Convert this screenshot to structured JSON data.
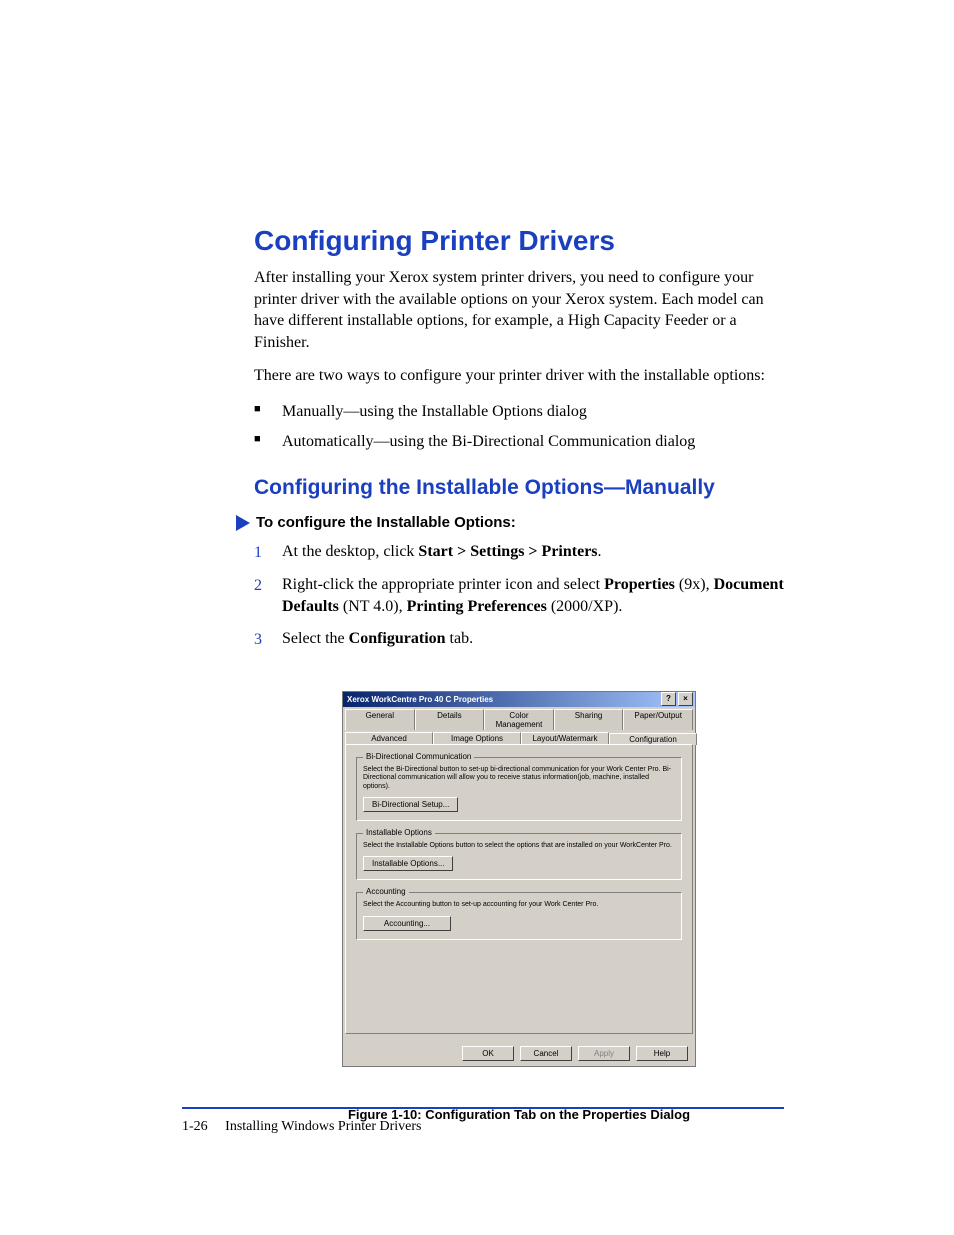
{
  "heading1": "Configuring Printer Drivers",
  "intro": "After installing your Xerox system printer drivers, you need to configure your printer driver with the available options on your Xerox system. Each model can have different installable options, for example, a High Capacity Feeder or a Finisher.",
  "intro2": "There are two ways to configure your printer driver with the installable options:",
  "bullets": [
    "Manually—using the Installable Options dialog",
    "Automatically—using the Bi-Directional Communication dialog"
  ],
  "heading2": "Configuring the Installable Options—Manually",
  "procLabel": "To configure the Installable Options:",
  "steps": {
    "s1a": "At the desktop, click ",
    "s1b": "Start > Settings > Printers",
    "s1c": ".",
    "s2a": "Right-click the appropriate printer icon and select ",
    "s2b": "Properties",
    "s2c": " (9x), ",
    "s2d": "Document Defaults",
    "s2e": " (NT 4.0), ",
    "s2f": "Printing Preferences",
    "s2g": " (2000/XP).",
    "s3a": "Select the ",
    "s3b": "Configuration",
    "s3c": " tab."
  },
  "dialog": {
    "title": "Xerox WorkCentre Pro 40 C Properties",
    "help": "?",
    "close": "×",
    "tabsRow1": [
      "General",
      "Details",
      "Color Management",
      "Sharing",
      "Paper/Output"
    ],
    "tabsRow2": [
      "Advanced",
      "Image Options",
      "Layout/Watermark",
      "Configuration"
    ],
    "group1": {
      "legend": "Bi-Directional Communication",
      "desc": "Select the Bi-Directional button to set-up bi-directional communication for your Work Center Pro. Bi-Directional communication will allow you to receive status information(job, machine, installed options).",
      "btn": "Bi-Directional Setup..."
    },
    "group2": {
      "legend": "Installable Options",
      "desc": "Select the Installable Options button to select the options that are installed on your WorkCenter Pro.",
      "btn": "Installable Options..."
    },
    "group3": {
      "legend": "Accounting",
      "desc": "Select the Accounting button to set-up accounting for your Work Center Pro.",
      "btn": "Accounting..."
    },
    "buttons": {
      "ok": "OK",
      "cancel": "Cancel",
      "apply": "Apply",
      "help": "Help"
    }
  },
  "figCaption": "Figure 1-10:  Configuration Tab on the Properties Dialog",
  "footer": {
    "page": "1-26",
    "title": "Installing Windows Printer Drivers"
  }
}
